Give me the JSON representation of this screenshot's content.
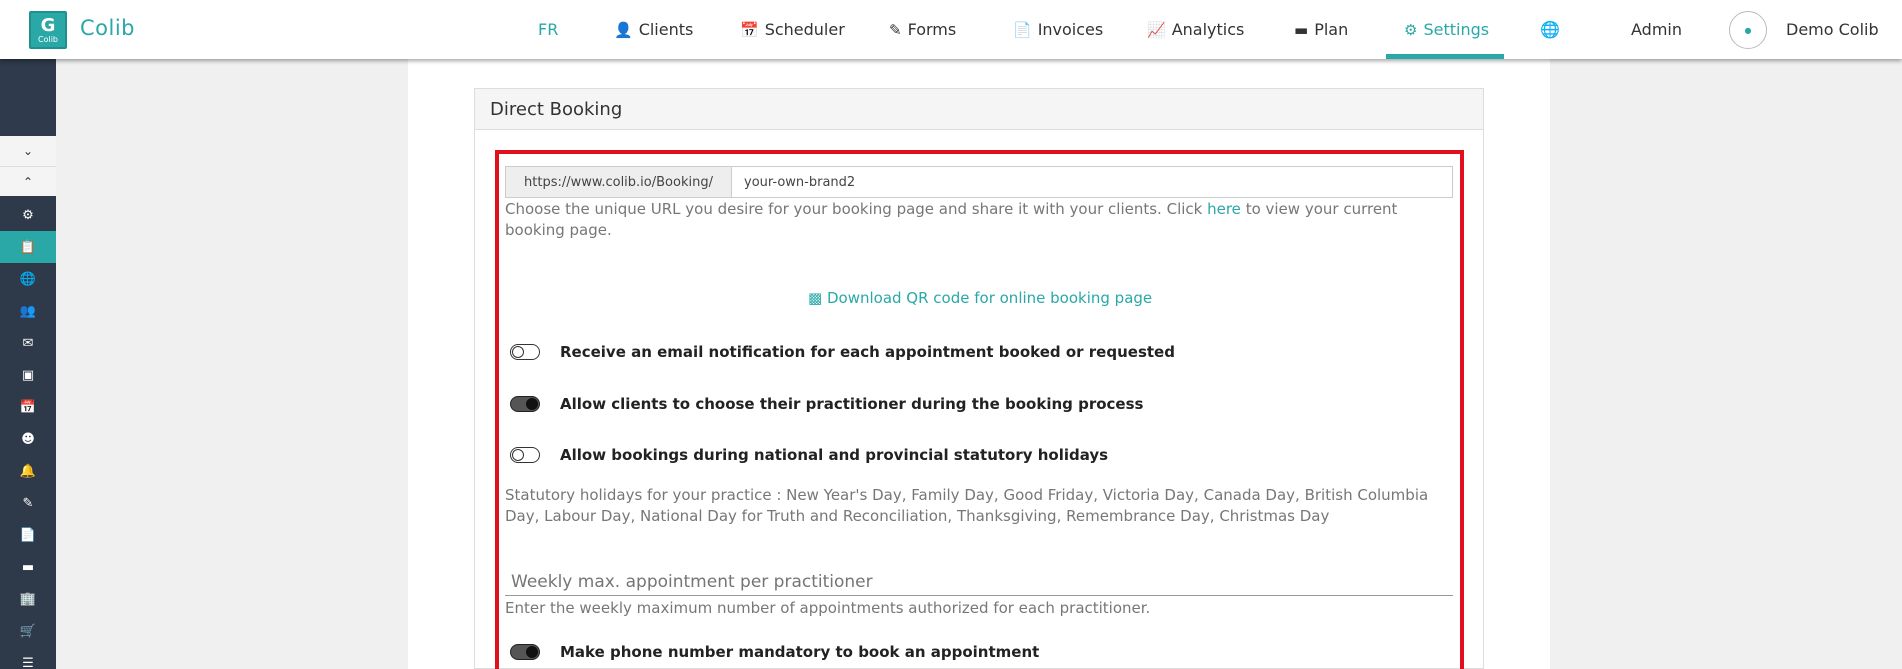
{
  "brand": {
    "name": "Colib",
    "logo_letter": "G",
    "logo_text": "Colib",
    "color": "#2aa8a8"
  },
  "nav": {
    "lang": "FR",
    "items": [
      {
        "label": "Clients",
        "icon": "user-icon"
      },
      {
        "label": "Scheduler",
        "icon": "calendar-icon"
      },
      {
        "label": "Forms",
        "icon": "forms-icon"
      },
      {
        "label": "Invoices",
        "icon": "invoice-icon"
      },
      {
        "label": "Analytics",
        "icon": "chart-icon"
      },
      {
        "label": "Plan",
        "icon": "card-icon"
      },
      {
        "label": "Settings",
        "icon": "gear-icon",
        "active": true
      }
    ],
    "globe_icon": "globe-icon",
    "admin": "Admin",
    "user_name": "Demo Colib"
  },
  "sidebar": {
    "icons": [
      "gear-icon",
      "clipboard-icon",
      "globe-icon",
      "users-icon",
      "envelope-icon",
      "note-icon",
      "calendar-icon",
      "contact-icon",
      "bell-icon",
      "edit-icon",
      "file-icon",
      "card-icon",
      "building-icon",
      "cart-icon",
      "list-icon"
    ],
    "active_index": 1
  },
  "panel": {
    "title": "Direct Booking",
    "url_prefix": "https://www.colib.io/Booking/",
    "url_value": "your-own-brand2",
    "url_help_before": "Choose the unique URL you desire for your booking page and share it with your clients. Click ",
    "url_help_link": "here",
    "url_help_after": " to view your current booking page.",
    "qr_label": "Download QR code for online booking page",
    "toggles": [
      {
        "label": "Receive an email notification for each appointment booked or requested",
        "on": false
      },
      {
        "label": "Allow clients to choose their practitioner during the booking process",
        "on": true
      },
      {
        "label": "Allow bookings during national and provincial statutory holidays",
        "on": false
      },
      {
        "label": "Make phone number mandatory to book an appointment",
        "on": true
      }
    ],
    "holidays_text": "Statutory holidays for your practice : New Year's Day, Family Day, Good Friday, Victoria Day, Canada Day, British Columbia Day, Labour Day, National Day for Truth and Reconciliation, Thanksgiving, Remembrance Day, Christmas Day",
    "weekly_placeholder": "Weekly max. appointment per practitioner",
    "weekly_help": "Enter the weekly maximum number of appointments authorized for each practitioner."
  }
}
